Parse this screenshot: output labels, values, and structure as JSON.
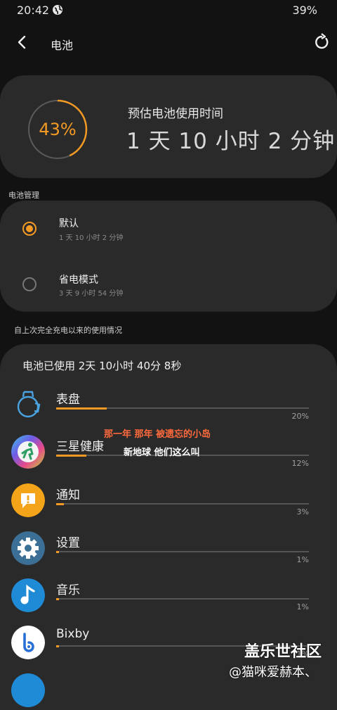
{
  "status_bar": {
    "time": "20:42",
    "battery": "39%"
  },
  "header": {
    "title": "电池"
  },
  "summary": {
    "percent": "43%",
    "percent_value": 0.43,
    "estimate_label": "预估电池使用时间",
    "estimate_value": "1 天 10 小时 2 分钟"
  },
  "battery_management": {
    "label": "电池管理",
    "modes": [
      {
        "title": "默认",
        "sub": "1 天 10 小时 2 分钟",
        "selected": true
      },
      {
        "title": "省电模式",
        "sub": "3 天 9 小时 54 分钟",
        "selected": false
      }
    ]
  },
  "usage": {
    "label": "自上次完全充电以来的使用情况",
    "used": "电池已使用 2天 10小时 40分 8秒",
    "apps": [
      {
        "name": "表盘",
        "percent": "20%",
        "value": 0.2,
        "icon": "watchface-icon"
      },
      {
        "name": "三星健康",
        "percent": "12%",
        "value": 0.12,
        "icon": "samsung-health-icon"
      },
      {
        "name": "通知",
        "percent": "3%",
        "value": 0.03,
        "icon": "notification-icon"
      },
      {
        "name": "设置",
        "percent": "1%",
        "value": 0.01,
        "icon": "settings-gear-icon"
      },
      {
        "name": "音乐",
        "percent": "1%",
        "value": 0.01,
        "icon": "music-note-icon"
      },
      {
        "name": "Bixby",
        "percent": "1%",
        "value": 0.01,
        "icon": "bixby-icon"
      }
    ]
  },
  "overlay_text": {
    "line1": "那一年 那年 被遗忘的小岛",
    "line2": "新地球 他们这么叫"
  },
  "watermark": {
    "site": "盖乐世社区",
    "user": "@猫咪爱赫本、"
  },
  "colors": {
    "accent": "#f39a24",
    "card": "#2a2a2a",
    "background": "#121212"
  }
}
